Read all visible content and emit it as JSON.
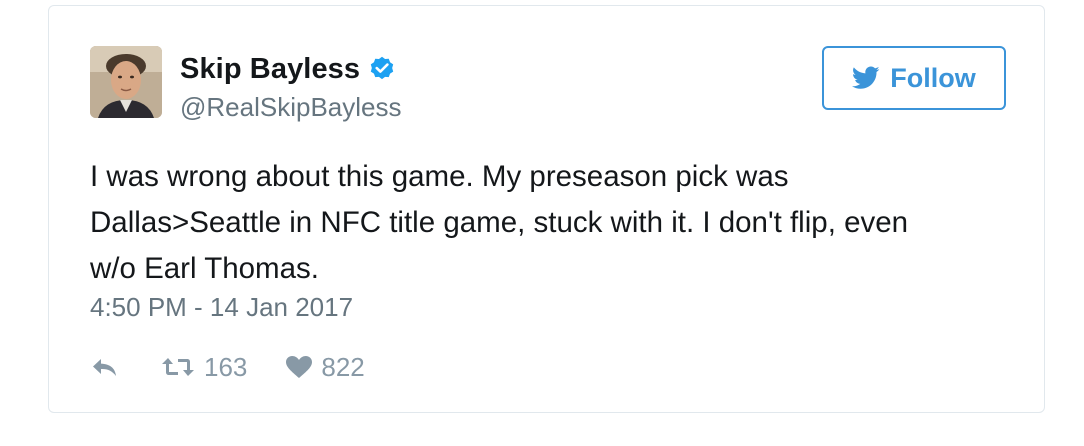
{
  "user": {
    "name": "Skip Bayless",
    "handle": "@RealSkipBayless",
    "verified": true
  },
  "follow_button": {
    "label": "Follow",
    "icon": "twitter-bird-icon"
  },
  "tweet": {
    "text": "I was wrong about this game. My preseason pick was\nDallas>Seattle in NFC title game, stuck with it. I don't flip, even\nw/o Earl Thomas.",
    "timestamp": "4:50 PM - 14 Jan 2017"
  },
  "actions": {
    "reply_icon": "reply-icon",
    "retweet_icon": "retweet-icon",
    "retweet_count": "163",
    "like_icon": "heart-icon",
    "like_count": "822"
  },
  "colors": {
    "accent": "#3b94d9",
    "verified": "#1da1f2",
    "text": "#14171a",
    "muted": "#66757f",
    "border": "#e1e8ed",
    "action": "#8899a6"
  }
}
